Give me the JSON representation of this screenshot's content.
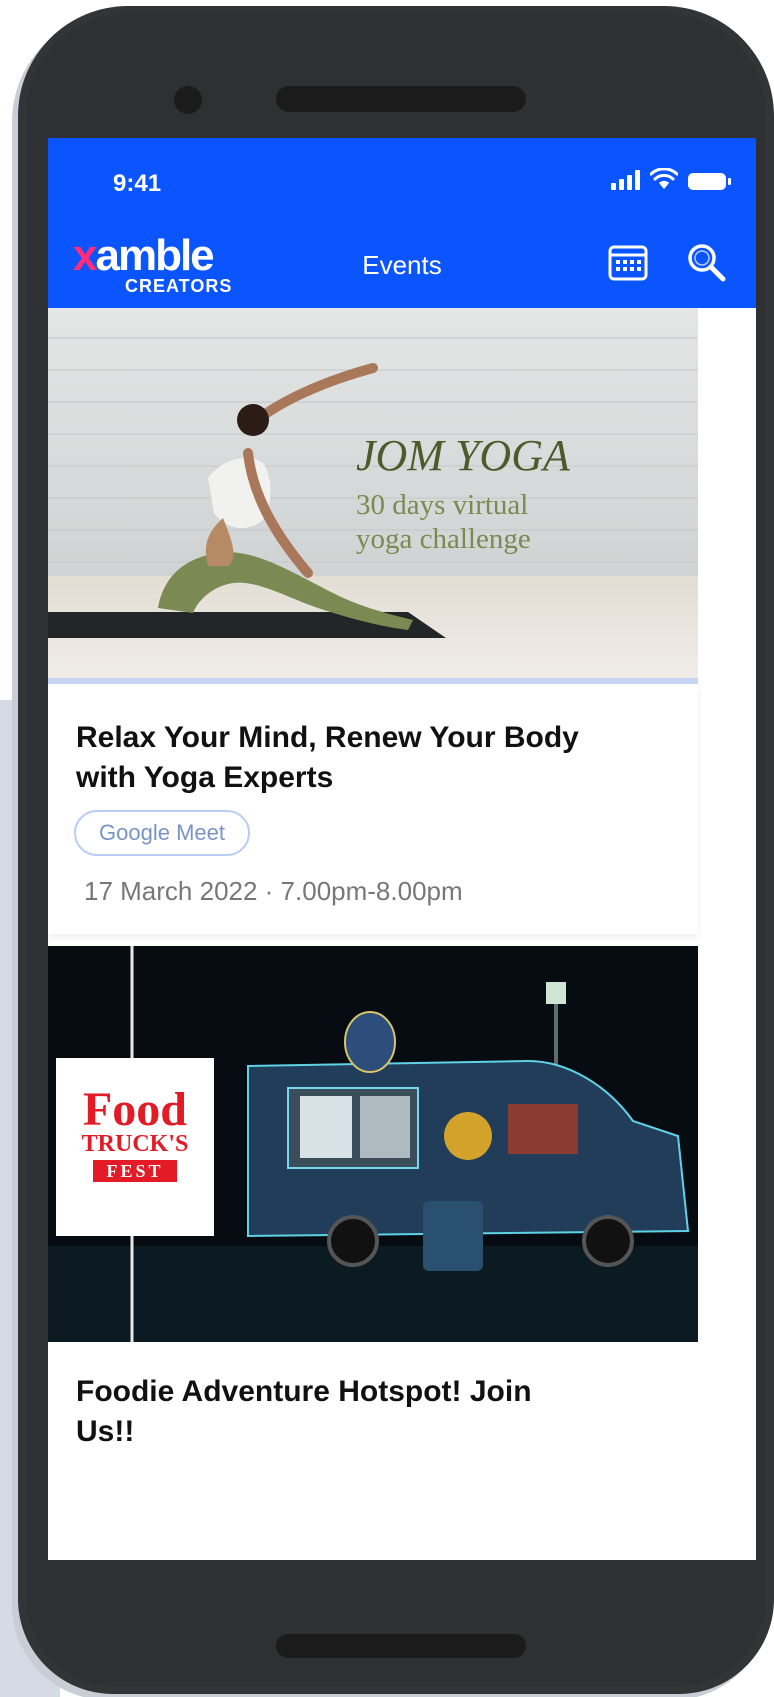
{
  "status": {
    "time": "9:41"
  },
  "appbar": {
    "logo_main_x": "x",
    "logo_main_rest": "amble",
    "logo_sub": "CREATORS",
    "title": "Events",
    "calendar_icon": "calendar-icon",
    "search_icon": "search-icon"
  },
  "events": [
    {
      "image_heading": "JOM YOGA",
      "image_sub1": "30 days virtual",
      "image_sub2": "yoga challenge",
      "title": "Relax Your Mind, Renew Your Body with Yoga Experts",
      "platform": "Google Meet",
      "datetime": "17 March 2022 · 7.00pm-8.00pm"
    },
    {
      "logo_line1": "Food",
      "logo_line2": "TRUCK'S",
      "logo_line3": "FEST",
      "title": "Foodie Adventure Hotspot! Join Us!!"
    }
  ],
  "colors": {
    "primary": "#0a55ff",
    "accent": "#ff2d7a",
    "chip_border": "#b9cdf7"
  }
}
